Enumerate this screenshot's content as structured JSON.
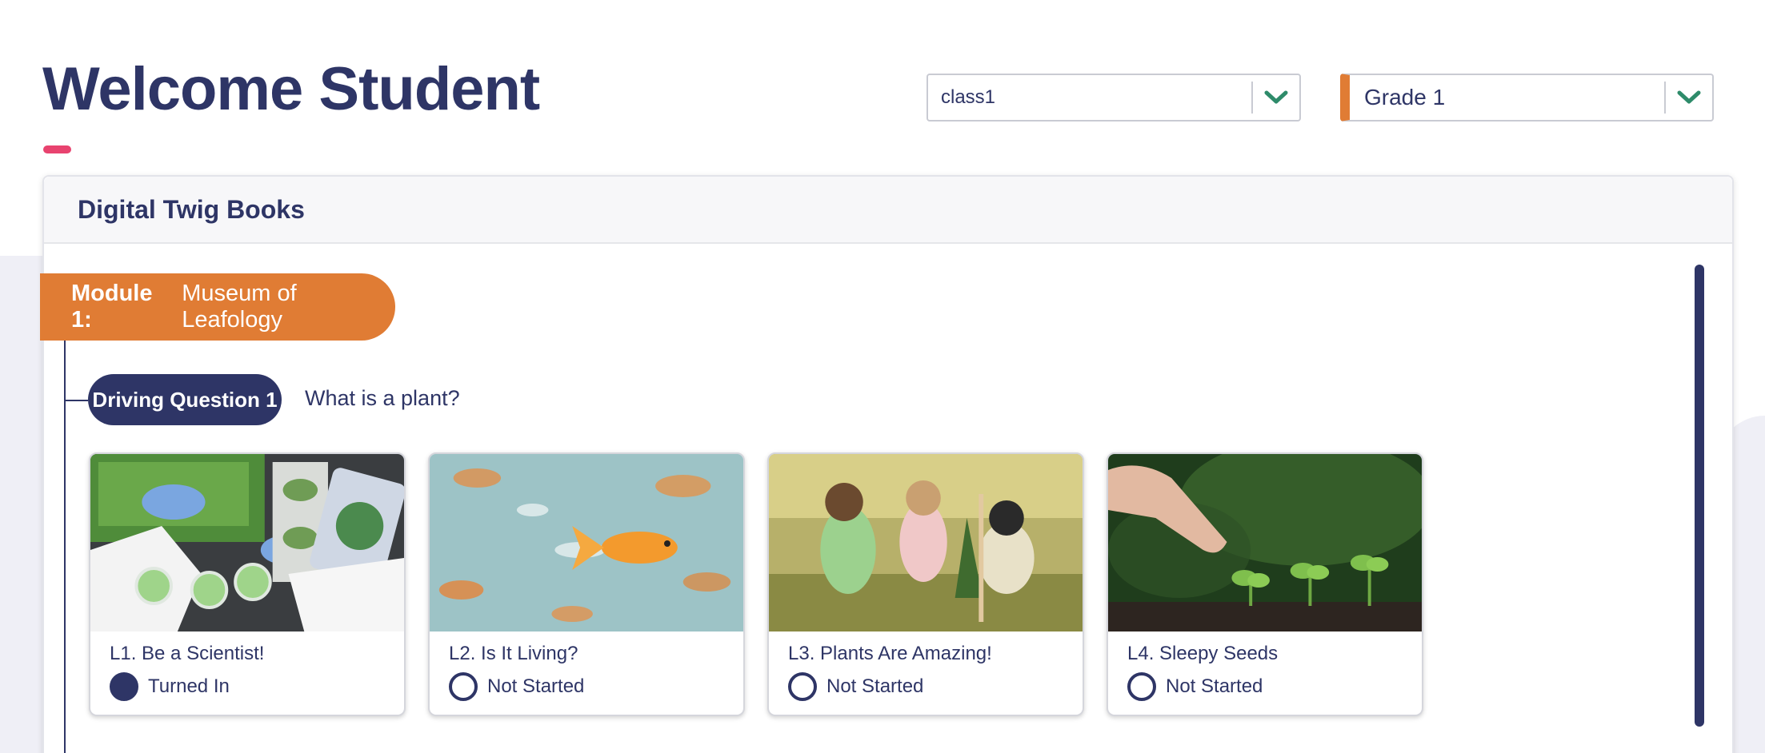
{
  "header": {
    "title": "Welcome Student",
    "accent_color": "#e8436f"
  },
  "filters": {
    "class_select": {
      "value": "class1",
      "icon": "chevron-down-icon"
    },
    "grade_select": {
      "value": "Grade 1",
      "icon": "chevron-down-icon",
      "accent_color": "#e07c34"
    }
  },
  "panel": {
    "title": "Digital Twig Books",
    "module": {
      "label": "Module 1:",
      "name": "Museum of Leafology",
      "color": "#e07c34"
    },
    "driving_question": {
      "label": "Driving Question 1",
      "text": "What is a plant?",
      "color": "#2e3566"
    },
    "lessons": [
      {
        "title": "L1. Be a Scientist!",
        "status": "Turned In",
        "status_icon": "filled-circle-icon",
        "image": "scientist-lab-photo"
      },
      {
        "title": "L2. Is It Living?",
        "status": "Not Started",
        "status_icon": "empty-circle-icon",
        "image": "goldfish-photo"
      },
      {
        "title": "L3. Plants Are Amazing!",
        "status": "Not Started",
        "status_icon": "empty-circle-icon",
        "image": "children-planting-photo"
      },
      {
        "title": "L4. Sleepy Seeds",
        "status": "Not Started",
        "status_icon": "empty-circle-icon",
        "image": "seedlings-photo"
      }
    ]
  },
  "colors": {
    "primary": "#2e3566",
    "orange": "#e07c34",
    "chevron": "#2e8b6a"
  }
}
